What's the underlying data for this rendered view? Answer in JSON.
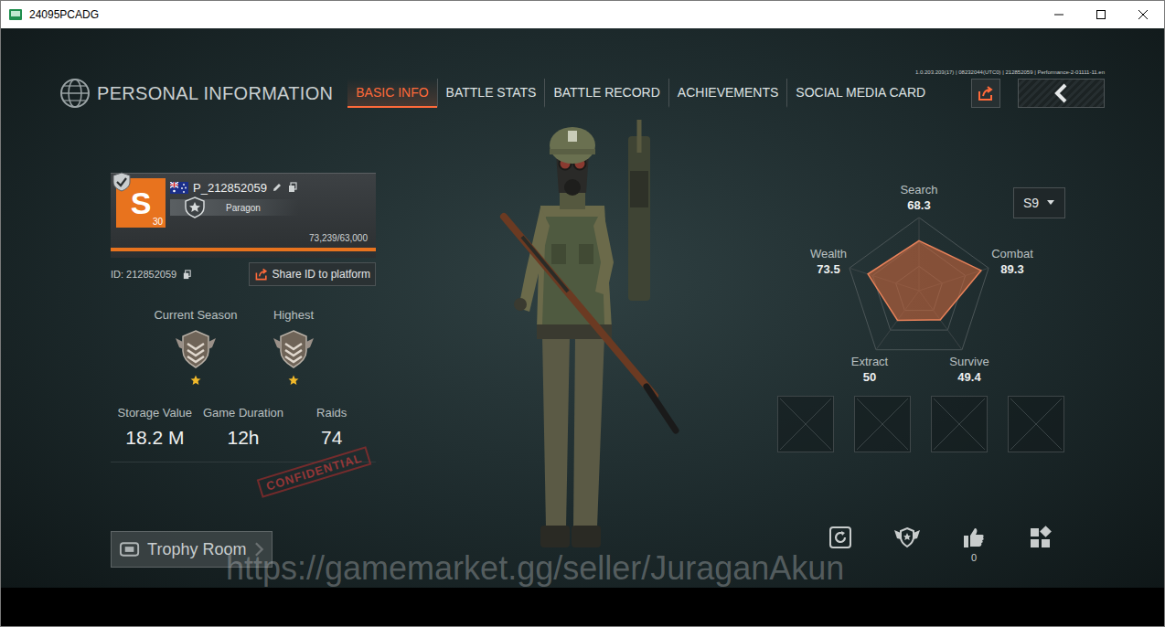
{
  "window": {
    "title": "24095PCADG"
  },
  "version": "1.0.203.203(17) | 08232044(UTC0) | 212852059 | Performance-2-01111-11.en",
  "header": {
    "title": "PERSONAL INFORMATION"
  },
  "tabs": [
    {
      "label": "BASIC INFO",
      "selected": true
    },
    {
      "label": "BATTLE STATS",
      "selected": false
    },
    {
      "label": "BATTLE RECORD",
      "selected": false
    },
    {
      "label": "ACHIEVEMENTS",
      "selected": false
    },
    {
      "label": "SOCIAL MEDIA CARD",
      "selected": false
    }
  ],
  "profile": {
    "avatar_letter": "S",
    "level": "30",
    "name": "P_212852059",
    "title": "Paragon",
    "xp": "73,239/63,000",
    "xp_level": 1,
    "id": "ID: 212852059",
    "share_button": "Share ID to platform"
  },
  "rank": [
    {
      "label": "Current Season",
      "stars": 1
    },
    {
      "label": "Highest",
      "stars": 1
    }
  ],
  "stats": [
    {
      "label": "Storage Value",
      "value": "18.2 M"
    },
    {
      "label": "Game Duration",
      "value": "12h"
    },
    {
      "label": "Raids",
      "value": "74"
    }
  ],
  "stamp": "CONFIDENTIAL",
  "trophy_button": "Trophy Room",
  "season": {
    "selected": "S9"
  },
  "radar": {
    "axes": [
      {
        "label": "Search",
        "value": "68.3"
      },
      {
        "label": "Combat",
        "value": "89.3"
      },
      {
        "label": "Survive",
        "value": "49.4"
      },
      {
        "label": "Extract",
        "value": "50"
      },
      {
        "label": "Wealth",
        "value": "73.5"
      }
    ],
    "series": [
      {
        "values": [
          68.3,
          89.3,
          49.4,
          50,
          73.5
        ]
      }
    ]
  },
  "slots": [
    {
      "filled": false
    },
    {
      "filled": false
    },
    {
      "filled": false
    },
    {
      "filled": false
    }
  ],
  "likes": "0",
  "watermark": "https://gamemarket.gg/seller/JuraganAkun"
}
